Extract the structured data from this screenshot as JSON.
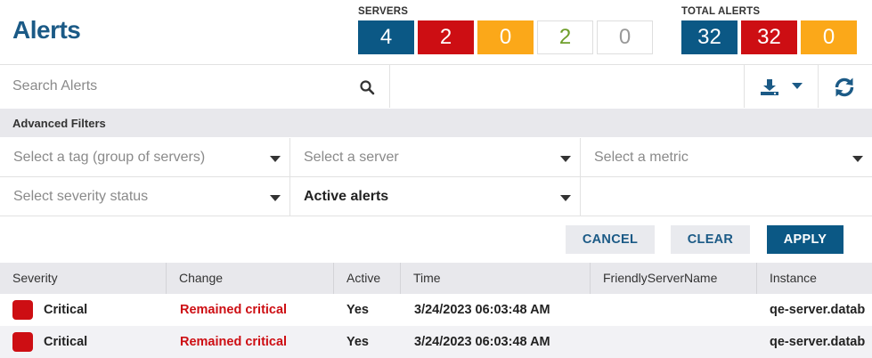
{
  "header": {
    "title": "Alerts"
  },
  "servers": {
    "label": "SERVERS",
    "counts": [
      "4",
      "2",
      "0",
      "2",
      "0"
    ],
    "colors": {
      "blue": "#0b5885",
      "red": "#cd0e13",
      "orange": "#fba819",
      "green_text": "#6e9e2a",
      "grey_text": "#999999"
    }
  },
  "total_alerts": {
    "label": "TOTAL ALERTS",
    "counts": [
      "32",
      "32",
      "0"
    ]
  },
  "search": {
    "placeholder": "Search Alerts",
    "icon": "search-icon"
  },
  "toolbar": {
    "export_icon": "download-icon",
    "refresh_icon": "refresh-icon"
  },
  "filters": {
    "title": "Advanced Filters",
    "tag_placeholder": "Select a tag (group of servers)",
    "server_placeholder": "Select a server",
    "metric_placeholder": "Select a metric",
    "severity_placeholder": "Select severity status",
    "alerts_value": "Active alerts"
  },
  "actions": {
    "cancel": "CANCEL",
    "clear": "CLEAR",
    "apply": "APPLY"
  },
  "table": {
    "columns": [
      "Severity",
      "Change",
      "Active",
      "Time",
      "FriendlyServerName",
      "Instance"
    ],
    "rows": [
      {
        "severity": "Critical",
        "change": "Remained critical",
        "active": "Yes",
        "time": "3/24/2023 06:03:48 AM",
        "friendly": "",
        "instance": "qe-server.datab"
      },
      {
        "severity": "Critical",
        "change": "Remained critical",
        "active": "Yes",
        "time": "3/24/2023 06:03:48 AM",
        "friendly": "",
        "instance": "qe-server.datab"
      }
    ]
  }
}
